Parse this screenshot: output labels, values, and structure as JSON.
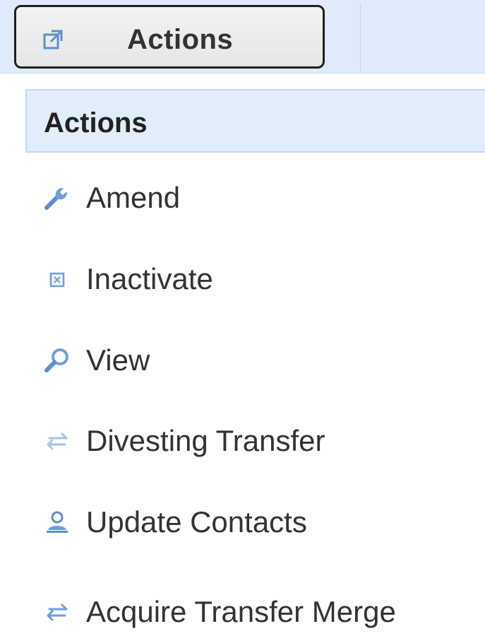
{
  "toolbar": {
    "actions_button_label": "Actions",
    "actions_button_icon": "external-link-icon"
  },
  "menu": {
    "header": "Actions",
    "items": [
      {
        "label": "Amend",
        "icon": "wrench-icon"
      },
      {
        "label": "Inactivate",
        "icon": "inactivate-box-icon"
      },
      {
        "label": "View",
        "icon": "magnifier-icon"
      },
      {
        "label": "Divesting Transfer",
        "icon": "transfer-arrows-icon"
      },
      {
        "label": "Update Contacts",
        "icon": "contact-person-icon"
      },
      {
        "label": "Acquire Transfer Merge",
        "icon": "transfer-arrows-icon"
      }
    ]
  },
  "colors": {
    "accent_icon": "#5b8fd0",
    "bar_background": "#dfeafb",
    "header_background": "#e2edfc"
  }
}
